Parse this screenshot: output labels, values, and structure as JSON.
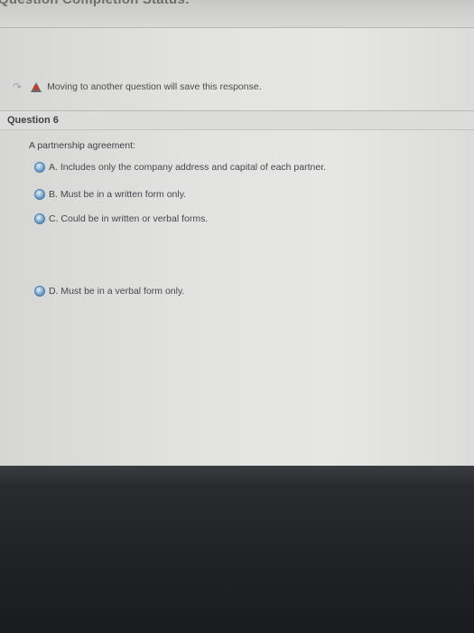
{
  "header": {
    "cut_title": "Question Completion Status:"
  },
  "notice": {
    "nav_icon": "nav-arrow-icon",
    "warning_icon": "warning-icon",
    "text": "Moving to another question will save this response."
  },
  "question": {
    "title": "Question 6",
    "prompt": "A partnership agreement:",
    "options": [
      {
        "label": "A. Includes only the company address and capital of each partner."
      },
      {
        "label": "B. Must be in a written form only."
      },
      {
        "label": "C. Could be in written or verbal forms."
      },
      {
        "label": "D. Must be in a verbal form only."
      }
    ]
  },
  "colors": {
    "radio": "#4d7ea8",
    "warning": "#c0392b",
    "background": "#e2e3e1",
    "frame": "#23252a"
  }
}
